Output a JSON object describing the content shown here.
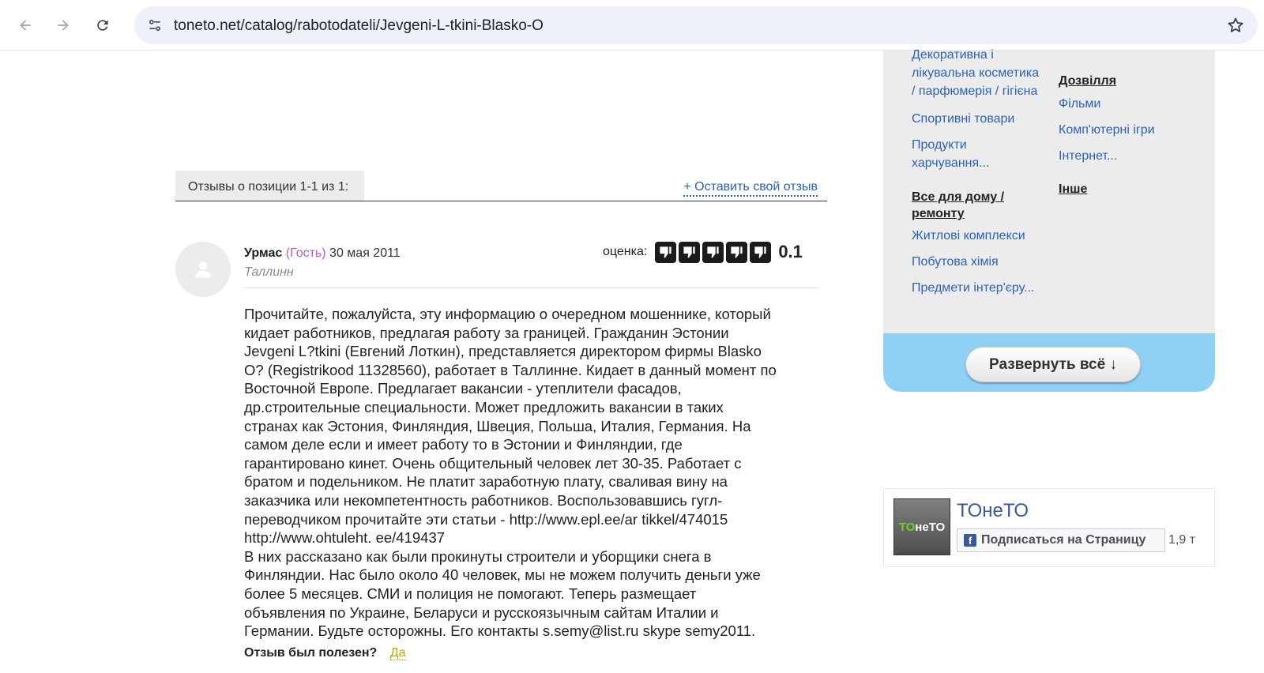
{
  "browser": {
    "url": "toneto.net/catalog/rabotodateli/Jevgeni-L-tkini-Blasko-O"
  },
  "reviews": {
    "header": "Отзывы о позиции 1-1 из 1:",
    "leave_review": "+ Оставить свой отзыв",
    "items": [
      {
        "author": "Урмас",
        "guest": "(Гость)",
        "date": "30 мая 2011",
        "city": "Таллинн",
        "rating_label": "оценка:",
        "rating_value": "0.1",
        "thumbs_count": 5,
        "text_lines": [
          "Прочитайте, пожалуйста, эту информацию о очередном мошеннике, который",
          "кидает работников, предлагая работу за границей. Гражданин Эстонии",
          "Jevgeni L?tkini (Евгений Лоткин), представляется директором фирмы Blasko",
          "O? (Registrikood 11328560), работает в Таллинне. Кидает в данный момент по",
          "Восточной Европе. Предлагает вакансии - утеплители фасадов,",
          "др.строительные специальности. Может предложить вакансии в таких",
          "странах как Эстония, Финляндия, Швеция, Польша, Италия, Германия. На",
          "самом деле если и имеет работу то в Эстонии и Финляндии, где",
          "гарантировано кинет. Очень общительный человек лет 30-35. Работает с",
          "братом и подельником. Не платит заработную плату, сваливая вину на",
          "заказчика или некомпетентность работников. Воспользовавшись гугл-",
          "переводчиком прочитайте эти статьи - http://www.epl.ee/ar tikkel/474015",
          "http://www.ohtuleht. ee/419437",
          "В них рассказано как были прокинуты строители и уборщики снега в",
          "Финляндии. Нас было около 40 человек, мы не можем получить деньги уже",
          "более 5 месяцев. СМИ и полиция не помогают. Теперь размещает",
          "объявления по Украине, Беларуси и русскоязычным сайтам Италии и",
          "Германии. Будьте осторожны. Его контакты s.semy@list.ru skype semy2011."
        ],
        "helpful_question": "Отзыв был полезен?",
        "helpful_yes": "Да"
      }
    ]
  },
  "sidebar": {
    "col1": {
      "link1": "Декоративна і лікувальна косметика / парфюмерія / гігієна",
      "link1_lines": [
        "Декоративна і",
        "лікувальна косметика",
        "/ парфюмерія / гігієна"
      ],
      "link2": "Спортивні товари",
      "link3_lines": [
        "Продукти",
        "харчування..."
      ],
      "heading_lines": [
        "Все для дому /",
        "ремонту"
      ],
      "link4": "Житлові комплекси",
      "link5": "Побутова хімія",
      "link6": "Предмети інтер'єру..."
    },
    "col2": {
      "heading1": "Дозвілля",
      "link1": "Фільми",
      "link2": "Комп'ютерні ігри",
      "link3": "Інтернет...",
      "heading2": "Інше"
    },
    "expand_button": "Развернуть всё ↓"
  },
  "facebook": {
    "logo_green": "ТО",
    "logo_white": "неТО",
    "page_name": "ТОнеТО",
    "subscribe": "Подписаться на Страницу",
    "f_letter": "f",
    "count": "1,9 т"
  },
  "colors": {
    "link": "#2a62b9",
    "guest": "#c25ac7",
    "panel_bg": "#ececec",
    "expand_band": "#8fd0f5",
    "facebook": "#3b5998"
  }
}
